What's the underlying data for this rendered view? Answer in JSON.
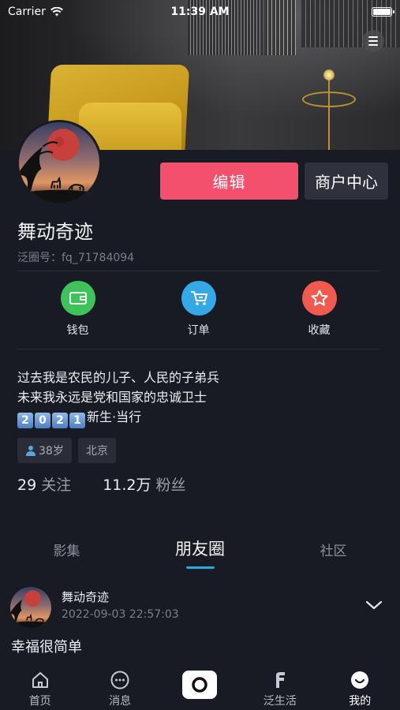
{
  "status_bar": {
    "carrier": "Carrier",
    "time": "11:39 AM"
  },
  "profile": {
    "edit_label": "编辑",
    "merchant_label": "商户中心",
    "name": "舞动奇迹",
    "id_label": "泛圈号",
    "id_value": "fq_71784094",
    "id_text": "泛圈号：fq_71784094"
  },
  "quick_actions": [
    {
      "label": "钱包",
      "icon": "wallet-icon",
      "color": "#3ec35a"
    },
    {
      "label": "订单",
      "icon": "cart-icon",
      "color": "#35a8e6"
    },
    {
      "label": "收藏",
      "icon": "star-icon",
      "color": "#f05a4f"
    }
  ],
  "bio": {
    "line1": "过去我是农民的儿子、人民的子弟兵",
    "line2": "未来我永远是党和国家的忠诚卫士",
    "digits": [
      "2",
      "0",
      "2",
      "1"
    ],
    "line3_suffix": "新生·当行"
  },
  "tags": {
    "age": "38岁",
    "city": "北京"
  },
  "stats": {
    "following_count": "29",
    "following_label": "关注",
    "followers_count": "11.2万",
    "followers_label": "粉丝"
  },
  "tabs": [
    "影集",
    "朋友圈",
    "社区"
  ],
  "active_tab": "朋友圈",
  "post": {
    "author": "舞动奇迹",
    "time": "2022-09-03 22:57:03",
    "text": "幸福很简单"
  },
  "bottom_nav": [
    {
      "label": "首页",
      "icon": "home-icon"
    },
    {
      "label": "消息",
      "icon": "message-icon"
    },
    {
      "label": "",
      "icon": "camera-icon"
    },
    {
      "label": "泛生活",
      "icon": "f-logo-icon"
    },
    {
      "label": "我的",
      "icon": "profile-smile-icon"
    }
  ],
  "colors": {
    "background": "#181b24",
    "edit_button": "#f2506c",
    "tab_indicator": "#2aa8e0"
  }
}
